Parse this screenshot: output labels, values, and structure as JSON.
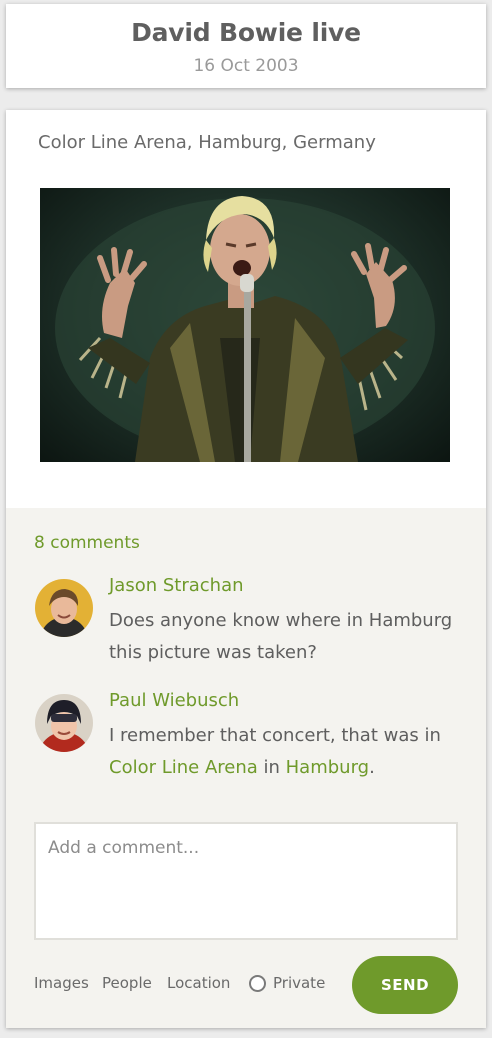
{
  "header": {
    "title": "David Bowie live",
    "date": "16 Oct 2003"
  },
  "post": {
    "location": "Color Line Arena, Hamburg, Germany",
    "photo_alt": "David Bowie singing into a microphone on stage"
  },
  "comments": {
    "count_label": "8 comments",
    "items": [
      {
        "author": "Jason Strachan",
        "text": "Does anyone know where in Hamburg this picture was taken?"
      },
      {
        "author": "Paul Wiebusch",
        "text_before": "I remember that concert, that was in ",
        "link1": "Color Line Arena",
        "text_middle": " in ",
        "link2": "Hamburg",
        "text_after": "."
      }
    ]
  },
  "compose": {
    "placeholder": "Add a comment...",
    "tools": {
      "images": "Images",
      "people": "People",
      "location": "Location",
      "private": "Private"
    },
    "send_label": "SEND"
  },
  "colors": {
    "accent": "#6f9a2b",
    "text": "#5e5e5e",
    "section_bg": "#f4f3ef"
  }
}
